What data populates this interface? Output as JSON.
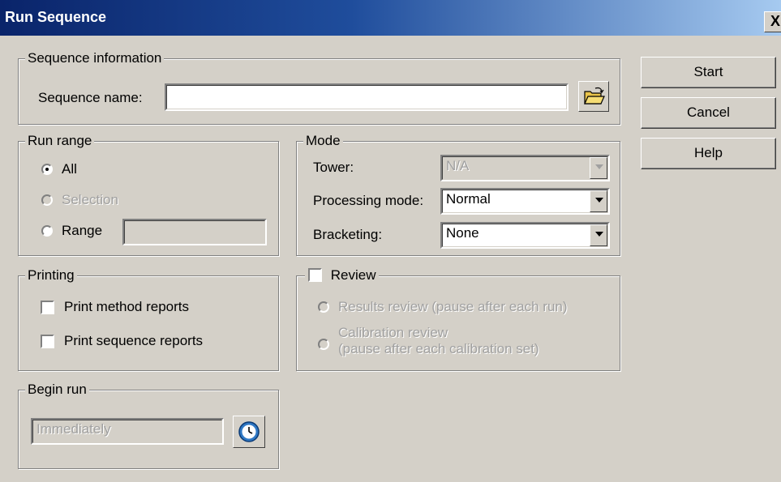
{
  "window": {
    "title": "Run Sequence",
    "close_glyph": "X"
  },
  "sequence_info": {
    "legend": "Sequence information",
    "name_label": "Sequence name:",
    "name_value": "",
    "browse_icon": "open-folder-icon"
  },
  "buttons": {
    "start": "Start",
    "cancel": "Cancel",
    "help": "Help"
  },
  "run_range": {
    "legend": "Run range",
    "options": [
      {
        "label": "All",
        "selected": true,
        "enabled": true
      },
      {
        "label": "Selection",
        "selected": false,
        "enabled": false
      },
      {
        "label": "Range",
        "selected": false,
        "enabled": true
      }
    ],
    "range_value": ""
  },
  "mode": {
    "legend": "Mode",
    "tower_label": "Tower:",
    "tower_value": "N/A",
    "processing_label": "Processing mode:",
    "processing_value": "Normal",
    "bracketing_label": "Bracketing:",
    "bracketing_value": "None"
  },
  "printing": {
    "legend": "Printing",
    "print_method_reports": "Print method reports",
    "print_sequence_reports": "Print sequence reports"
  },
  "review": {
    "legend": "Review",
    "checked": false,
    "results_review": "Results review (pause after each run)",
    "calibration_review_line1": "Calibration review",
    "calibration_review_line2": "(pause after each calibration set)"
  },
  "begin_run": {
    "legend": "Begin run",
    "value": "Immediately",
    "clock_icon": "clock-icon"
  }
}
